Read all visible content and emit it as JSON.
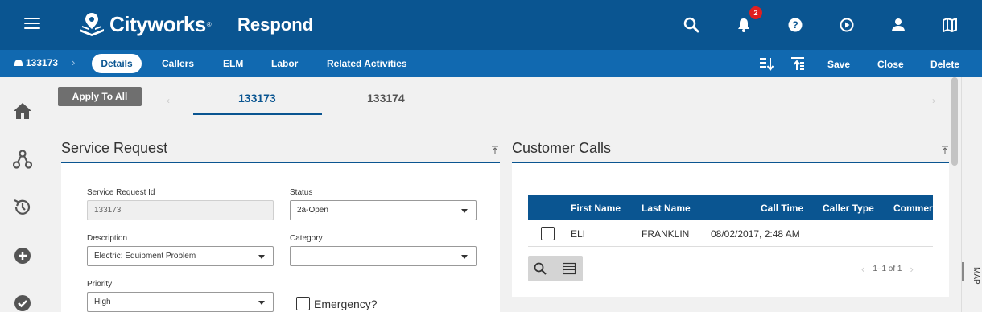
{
  "app": {
    "brand": "Cityworks",
    "trademark": "®",
    "module": "Respond",
    "notification_count": "2"
  },
  "topbar_icons": [
    "menu-icon",
    "search-icon",
    "bell-icon",
    "help-icon",
    "play-icon",
    "user-icon",
    "map-icon"
  ],
  "subnav": {
    "record_id": "133173",
    "separator": "›",
    "tabs": [
      "Details",
      "Callers",
      "ELM",
      "Labor",
      "Related Activities"
    ],
    "actions": {
      "save": "Save",
      "close": "Close",
      "delete": "Delete"
    }
  },
  "sidebar_icons": [
    "home-icon",
    "workflow-icon",
    "history-icon",
    "add-icon",
    "check-icon"
  ],
  "toolbar": {
    "apply_to_all": "Apply To All"
  },
  "record_tabs": [
    "133173",
    "133174"
  ],
  "record_tabs_active": "133173",
  "service_request": {
    "title": "Service Request",
    "fields": {
      "id_label": "Service Request Id",
      "id_value": "133173",
      "status_label": "Status",
      "status_value": "2a-Open",
      "description_label": "Description",
      "description_value": "Electric: Equipment Problem",
      "category_label": "Category",
      "category_value": "",
      "priority_label": "Priority",
      "priority_value": "High",
      "emergency_label": "Emergency?",
      "emergency_checked": false
    }
  },
  "customer_calls": {
    "title": "Customer Calls",
    "columns": [
      "First Name",
      "Last Name",
      "Call Time",
      "Caller Type",
      "Commer"
    ],
    "rows": [
      {
        "first_name": "ELI",
        "last_name": "FRANKLIN",
        "call_time": "08/02/2017, 2:48 AM",
        "caller_type": "",
        "comments": ""
      }
    ],
    "pager": "1–1 of 1"
  },
  "map_rail": {
    "label": "MAP"
  },
  "colors": {
    "primary": "#0a5591",
    "subnav": "#1169b0",
    "badge": "#e02020"
  }
}
